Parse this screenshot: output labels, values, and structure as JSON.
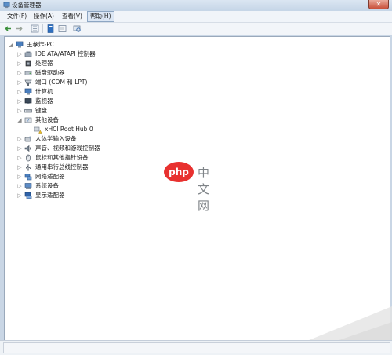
{
  "window": {
    "title": "设备管理器",
    "close_glyph": "✕"
  },
  "menu": [
    {
      "label": "文件(F)"
    },
    {
      "label": "操作(A)"
    },
    {
      "label": "查看(V)"
    },
    {
      "label": "帮助(H)"
    }
  ],
  "toolbar": {
    "buttons": [
      {
        "icon": "back-arrow-icon"
      },
      {
        "icon": "forward-arrow-icon"
      },
      {
        "icon": "tree-view-icon"
      },
      {
        "icon": "properties-icon"
      },
      {
        "icon": "help-icon"
      },
      {
        "icon": "scan-hardware-icon"
      }
    ]
  },
  "tree": {
    "root": {
      "label": "王孝炸-PC",
      "icon": "computer-root-icon"
    },
    "nodes": [
      {
        "label": "IDE ATA/ATAPI 控制器",
        "icon": "ide-controller-icon"
      },
      {
        "label": "处理器",
        "icon": "processor-icon"
      },
      {
        "label": "磁盘驱动器",
        "icon": "disk-drive-icon"
      },
      {
        "label": "端口 (COM 和 LPT)",
        "icon": "port-icon"
      },
      {
        "label": "计算机",
        "icon": "computer-icon"
      },
      {
        "label": "监视器",
        "icon": "monitor-icon"
      },
      {
        "label": "键盘",
        "icon": "keyboard-icon"
      },
      {
        "label": "其他设备",
        "icon": "other-devices-icon",
        "expanded": true,
        "children": [
          {
            "label": "xHCI Root Hub 0",
            "icon": "unknown-device-warning-icon"
          }
        ]
      },
      {
        "label": "人体学输入设备",
        "icon": "hid-icon"
      },
      {
        "label": "声音、视频和游戏控制器",
        "icon": "sound-icon"
      },
      {
        "label": "鼠标和其他指针设备",
        "icon": "mouse-icon"
      },
      {
        "label": "通用串行总线控制器",
        "icon": "usb-icon"
      },
      {
        "label": "网络适配器",
        "icon": "network-adapter-icon"
      },
      {
        "label": "系统设备",
        "icon": "system-devices-icon"
      },
      {
        "label": "显示适配器",
        "icon": "display-adapter-icon"
      }
    ]
  },
  "watermark": {
    "logo_text": "php",
    "text": "中文网"
  },
  "colors": {
    "accent": "#1f6fc5",
    "pane_border": "#9aa9bb",
    "window_frame": "#c9d6e5"
  }
}
